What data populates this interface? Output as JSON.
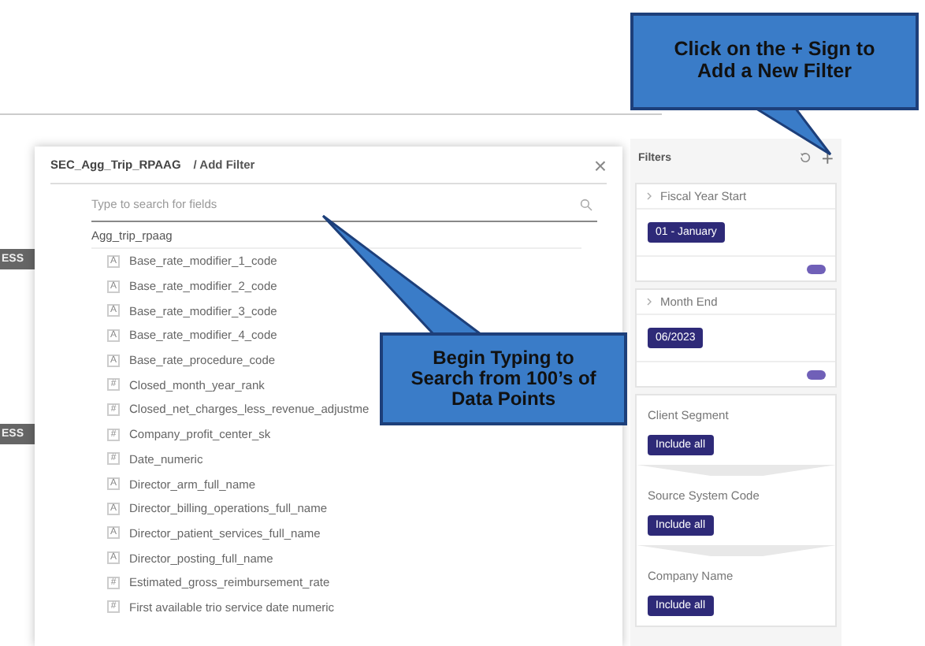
{
  "background": {
    "tags": [
      "ESS",
      "ESS"
    ]
  },
  "dialog": {
    "title": "SEC_Agg_Trip_RPAAG",
    "subtitle": "/ Add Filter",
    "close": "×",
    "search": {
      "placeholder": "Type to search for fields"
    },
    "group": "Agg_trip_rpaag",
    "fields": [
      {
        "type": "A",
        "name": "Base_rate_modifier_1_code"
      },
      {
        "type": "A",
        "name": "Base_rate_modifier_2_code"
      },
      {
        "type": "A",
        "name": "Base_rate_modifier_3_code"
      },
      {
        "type": "A",
        "name": "Base_rate_modifier_4_code"
      },
      {
        "type": "A",
        "name": "Base_rate_procedure_code"
      },
      {
        "type": "#",
        "name": "Closed_month_year_rank"
      },
      {
        "type": "#",
        "name": "Closed_net_charges_less_revenue_adjustme"
      },
      {
        "type": "#",
        "name": "Company_profit_center_sk"
      },
      {
        "type": "#",
        "name": "Date_numeric"
      },
      {
        "type": "A",
        "name": "Director_arm_full_name"
      },
      {
        "type": "A",
        "name": "Director_billing_operations_full_name"
      },
      {
        "type": "A",
        "name": "Director_patient_services_full_name"
      },
      {
        "type": "A",
        "name": "Director_posting_full_name"
      },
      {
        "type": "#",
        "name": "Estimated_gross_reimbursement_rate"
      },
      {
        "type": "#",
        "name": "First available trio service date numeric"
      }
    ]
  },
  "filters": {
    "title": "Filters",
    "add": "+",
    "cards": [
      {
        "kind": "date",
        "label": "Fiscal Year Start",
        "value": "01 - January",
        "on": true
      },
      {
        "kind": "date",
        "label": "Month End",
        "value": "06/2023",
        "on": true
      },
      {
        "kind": "list",
        "label": "Client Segment",
        "value": "Include all"
      },
      {
        "kind": "list",
        "label": "Source System Code",
        "value": "Include all"
      },
      {
        "kind": "list",
        "label": "Company Name",
        "value": "Include all"
      }
    ]
  },
  "callouts": [
    {
      "kind": "top",
      "text": "Click on the + Sign to Add a New Filter"
    },
    {
      "kind": "middle",
      "text": "Begin Typing to Search from 100’s of Data Points"
    }
  ]
}
